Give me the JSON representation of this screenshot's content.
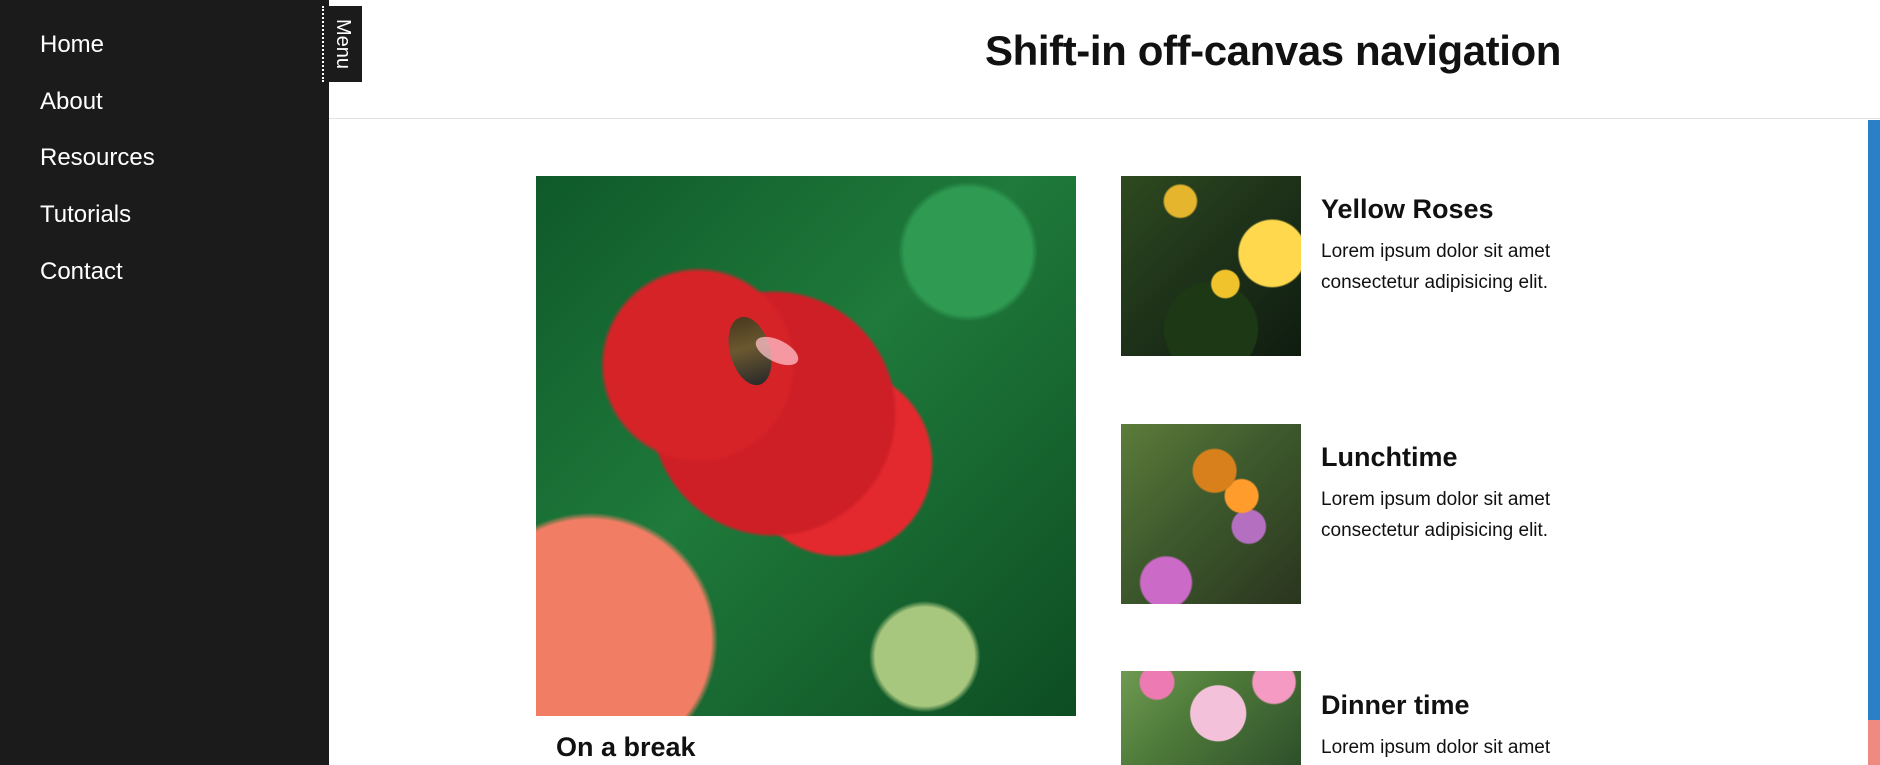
{
  "navigation": {
    "items": [
      {
        "label": "Home"
      },
      {
        "label": "About"
      },
      {
        "label": "Resources"
      },
      {
        "label": "Tutorials"
      },
      {
        "label": "Contact"
      }
    ],
    "toggle_label": "Menu"
  },
  "header": {
    "title": "Shift-in off-canvas navigation"
  },
  "cards": [
    {
      "title": "On a break",
      "image_semantic": "bee-on-red-flower-image"
    },
    {
      "title": "Yellow Roses",
      "text_lines": [
        "Lorem ipsum dolor sit amet",
        "consectetur adipisicing elit."
      ],
      "image_semantic": "yellow-roses-image"
    },
    {
      "title": "Lunchtime",
      "text_lines": [
        "Lorem ipsum dolor sit amet",
        "consectetur adipisicing elit."
      ],
      "image_semantic": "butterfly-on-thistle-image"
    },
    {
      "title": "Dinner time",
      "text_lines": [
        "Lorem ipsum dolor sit amet"
      ],
      "image_semantic": "bee-on-pink-flower-image"
    }
  ],
  "colors": {
    "nav_background": "#1b1b1b",
    "text": "#111111",
    "accent_blue": "#2b7fc7",
    "accent_coral": "#ee8a7f"
  }
}
